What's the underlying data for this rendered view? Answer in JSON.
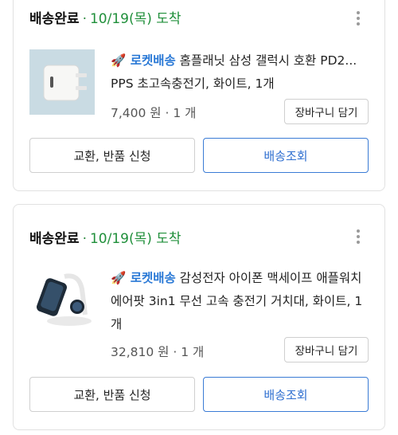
{
  "orders": [
    {
      "status_label": "배송완료",
      "status_separator": "·",
      "arrival": "10/19(목) 도착",
      "rocket_label": "🚀 로켓배송",
      "product_name": " 홈플래닛 삼성 갤럭시 호환 PD2... PPS 초고속충전기, 화이트, 1개",
      "price": "7,400 원 · 1 개",
      "cart_button": "장바구니 담기",
      "return_button": "교환, 반품 신청",
      "track_button": "배송조회"
    },
    {
      "status_label": "배송완료",
      "status_separator": "·",
      "arrival": "10/19(목) 도착",
      "rocket_label": "🚀 로켓배송",
      "product_name": " 감성전자 아이폰 맥세이프 애플워치 에어팟 3in1 무선 고속 충전기 거치대, 화이트, 1개",
      "price": "32,810 원 · 1 개",
      "cart_button": "장바구니 담기",
      "return_button": "교환, 반품 신청",
      "track_button": "배송조회"
    }
  ],
  "icons": {
    "more": "more-vertical-icon",
    "rocket": "rocket-icon",
    "charger": "charger-image",
    "stand": "wireless-stand-image"
  }
}
